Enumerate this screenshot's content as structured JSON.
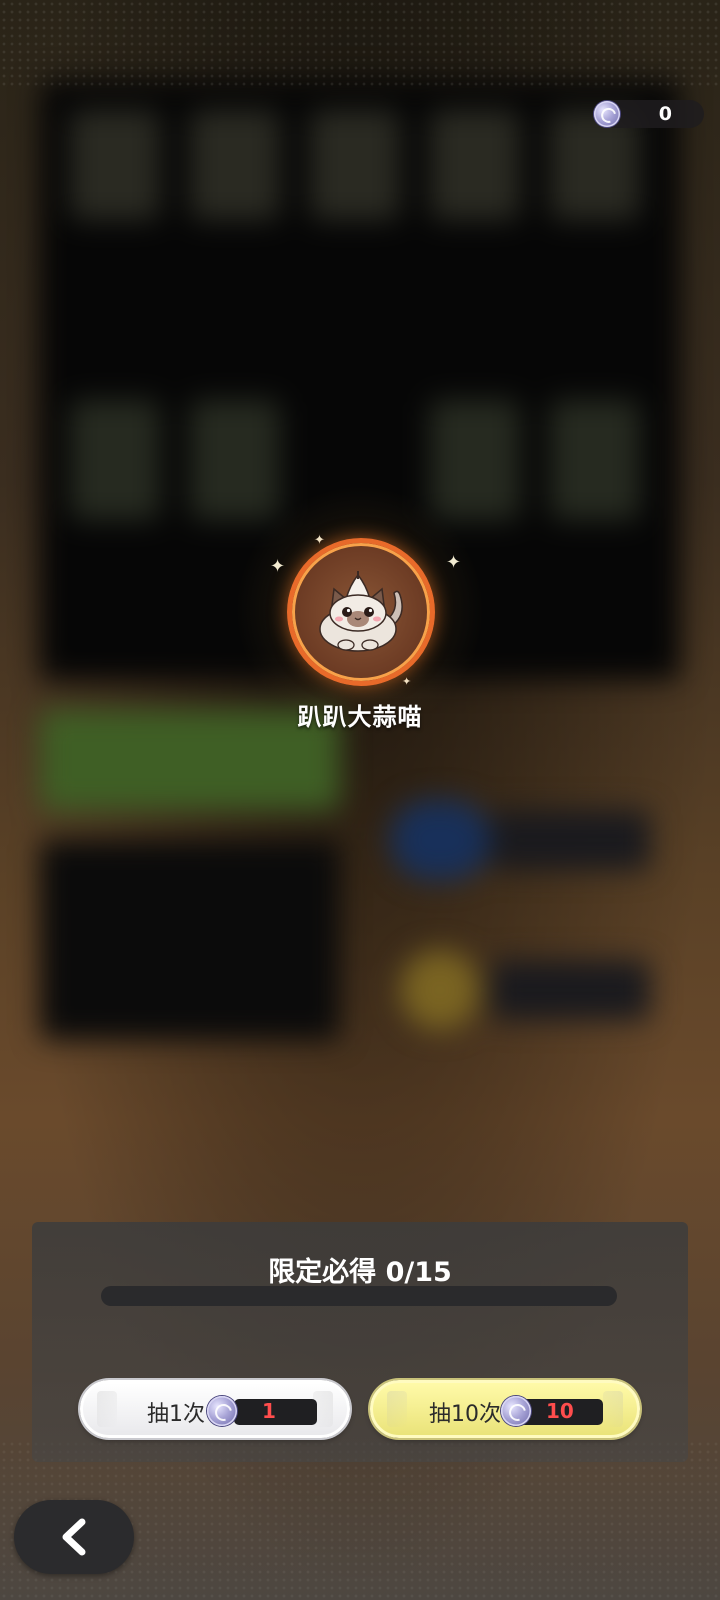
{
  "currency": {
    "icon": "crystal-coin-icon",
    "amount": "0"
  },
  "reward": {
    "icon": "garlic-cat-icon",
    "name": "趴趴大蒜喵"
  },
  "guarantee": {
    "label": "限定必得 0/15",
    "current": 0,
    "total": 15
  },
  "draw_buttons": [
    {
      "label": "抽1次",
      "cost": "1",
      "cost_icon": "crystal-coin-icon"
    },
    {
      "label": "抽10次",
      "cost": "10",
      "cost_icon": "crystal-coin-icon"
    }
  ],
  "navigation": {
    "back_icon": "chevron-left-icon"
  },
  "colors": {
    "reward_ring": "#e86a2a",
    "draw_ten_button": "#f0ea8a",
    "cost_text": "#ff4d4d"
  }
}
